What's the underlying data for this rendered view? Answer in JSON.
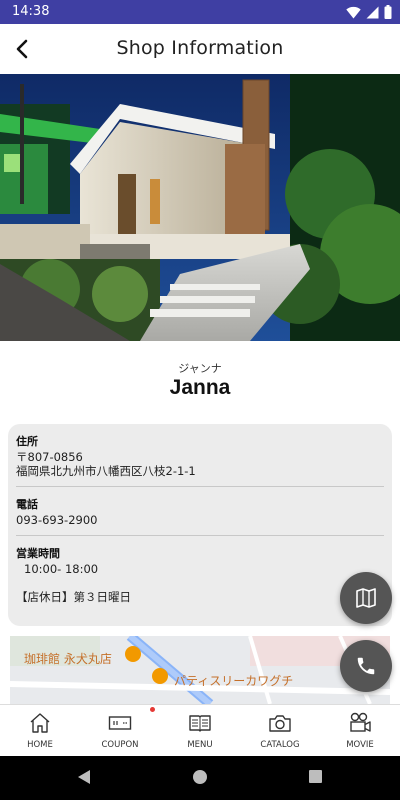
{
  "status_bar": {
    "time": "14:38",
    "icons": [
      "wifi-icon",
      "signal-icon",
      "battery-icon"
    ]
  },
  "header": {
    "title": "Shop Information",
    "back_icon": "back-arrow-icon"
  },
  "shop": {
    "kana": "ジャンナ",
    "name": "Janna"
  },
  "info": {
    "address_label": "住所",
    "postal_code": "〒807-0856",
    "address": "福岡県北九州市八幡西区八枝2-1-1",
    "phone_label": "電話",
    "phone": "093-693-2900",
    "hours_label": "営業時間",
    "hours": "10:00- 18:00",
    "closed": "【店休日】第３日曜日"
  },
  "map": {
    "poi_1": "珈琲館 永犬丸店",
    "poi_2": "パティスリーカワグチ"
  },
  "fab": {
    "map_icon": "map-icon",
    "phone_icon": "phone-icon"
  },
  "bottom_nav": {
    "items": [
      {
        "label": "HOME",
        "icon": "home-icon"
      },
      {
        "label": "COUPON",
        "icon": "coupon-icon"
      },
      {
        "label": "MENU",
        "icon": "menu-book-icon"
      },
      {
        "label": "CATALOG",
        "icon": "camera-icon"
      },
      {
        "label": "MOVIE",
        "icon": "movie-camera-icon"
      }
    ]
  },
  "colors": {
    "status_bar": "#3f3fa3",
    "card_bg": "#ececec",
    "fab_bg": "#555555",
    "map_label": "#c5702a",
    "badge_dot": "#e53935"
  }
}
